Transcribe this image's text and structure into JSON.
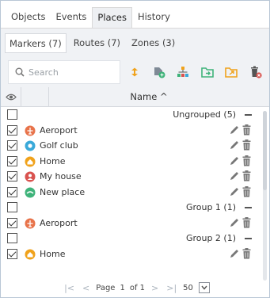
{
  "main_tabs": [
    {
      "label": "Objects",
      "active": false
    },
    {
      "label": "Events",
      "active": false
    },
    {
      "label": "Places",
      "active": true
    },
    {
      "label": "History",
      "active": false
    }
  ],
  "sub_tabs": [
    {
      "label": "Markers (7)",
      "active": true
    },
    {
      "label": "Routes (7)",
      "active": false
    },
    {
      "label": "Zones (3)",
      "active": false
    }
  ],
  "search": {
    "placeholder": "Search"
  },
  "toolbar_icons": [
    "sort-icon",
    "add-marker-icon",
    "group-icon",
    "import-icon",
    "export-icon",
    "delete-all-icon"
  ],
  "table": {
    "header_name": "Name ^"
  },
  "rows": [
    {
      "type": "group",
      "label": "Ungrouped (5)",
      "checked": false
    },
    {
      "type": "item",
      "label": "Aeroport",
      "checked": true,
      "icon": "airport-icon",
      "color": "#e8734a"
    },
    {
      "type": "item",
      "label": "Golf club",
      "checked": true,
      "icon": "golf-icon",
      "color": "#3aa9d9"
    },
    {
      "type": "item",
      "label": "Home",
      "checked": true,
      "icon": "home-icon",
      "color": "#f0a21b"
    },
    {
      "type": "item",
      "label": "My house",
      "checked": true,
      "icon": "person-icon",
      "color": "#d9534f"
    },
    {
      "type": "item",
      "label": "New place",
      "checked": true,
      "icon": "place-icon",
      "color": "#3fb37a"
    },
    {
      "type": "group",
      "label": "Group 1 (1)",
      "checked": false
    },
    {
      "type": "item",
      "label": "Aeroport",
      "checked": true,
      "icon": "airport-icon",
      "color": "#e8734a"
    },
    {
      "type": "group",
      "label": "Group 2 (1)",
      "checked": false
    },
    {
      "type": "item",
      "label": "Home",
      "checked": true,
      "icon": "home-icon",
      "color": "#f0a21b"
    }
  ],
  "pager": {
    "page_label": "Page",
    "page": "1",
    "of_label": "of 1",
    "per_page": "50"
  }
}
